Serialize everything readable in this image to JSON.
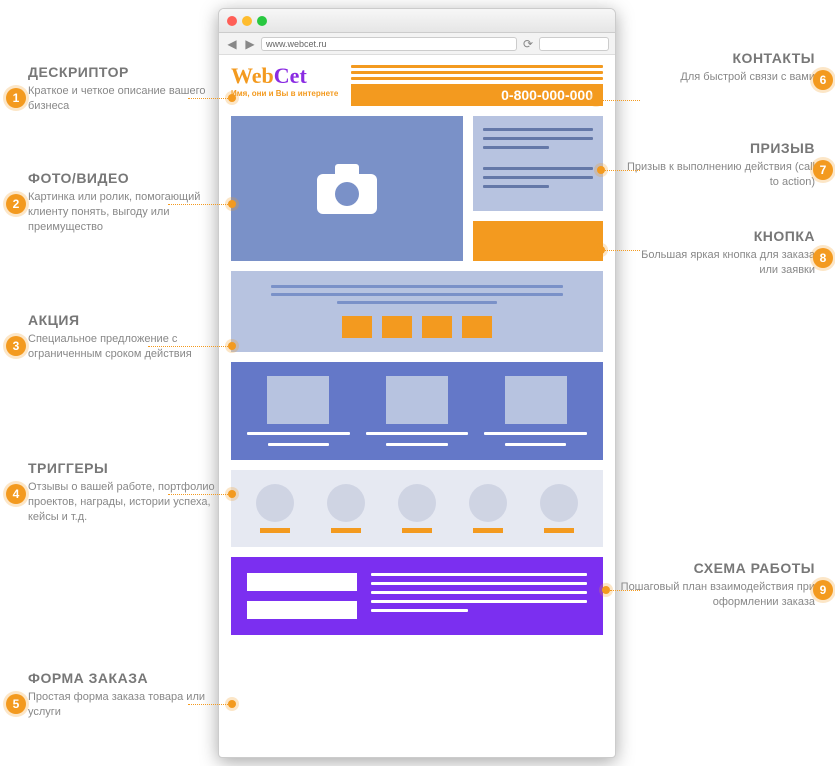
{
  "browser": {
    "url": "www.webcet.ru"
  },
  "header": {
    "logo_part1": "Web",
    "logo_part2": "Cet",
    "tagline": "Имя, они и Вы в интернете",
    "phone": "0-800-000-000"
  },
  "annotations": {
    "left": [
      {
        "num": "1",
        "title": "ДЕСКРИПТОР",
        "desc": "Краткое и четкое описание вашего бизнеса"
      },
      {
        "num": "2",
        "title": "ФОТО/ВИДЕО",
        "desc": "Картинка или ролик, помогающий клиенту понять, выгоду или преимущество"
      },
      {
        "num": "3",
        "title": "АКЦИЯ",
        "desc": "Специальное предложение с ограниченным сроком действия"
      },
      {
        "num": "4",
        "title": "ТРИГГЕРЫ",
        "desc": "Отзывы о вашей работе, портфолио проектов, награды, истории успеха, кейсы и т.д."
      },
      {
        "num": "5",
        "title": "ФОРМА ЗАКАЗА",
        "desc": "Простая форма заказа товара или услуги"
      }
    ],
    "right": [
      {
        "num": "6",
        "title": "КОНТАКТЫ",
        "desc": "Для быстрой связи с вами"
      },
      {
        "num": "7",
        "title": "ПРИЗЫВ",
        "desc": "Призыв к выполнению действия (call to action)"
      },
      {
        "num": "8",
        "title": "КНОПКА",
        "desc": "Большая яркая кнопка для заказа или заявки"
      },
      {
        "num": "9",
        "title": "СХЕМА РАБОТЫ",
        "desc": "Пошаговый план взаимодействия при оформлении заказа"
      }
    ]
  }
}
